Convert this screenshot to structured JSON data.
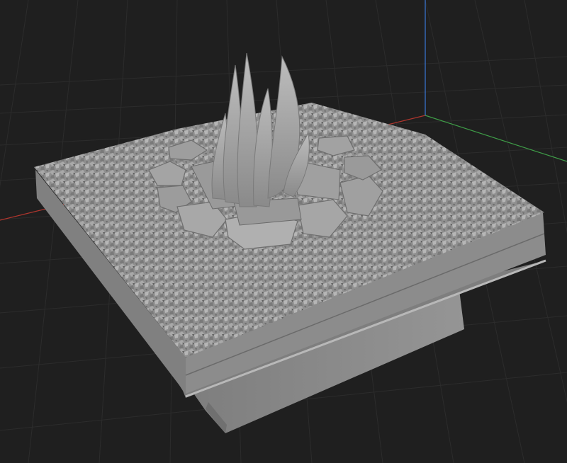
{
  "viewport": {
    "background": "#1f1f1f",
    "grid_color": "#2e2e2e",
    "axis_colors": {
      "x": "#c0392b",
      "y": "#4caf50",
      "z": "#3f7fe0"
    }
  },
  "model": {
    "object": "campfire-diorama",
    "material_color": "#9a9a9a"
  }
}
